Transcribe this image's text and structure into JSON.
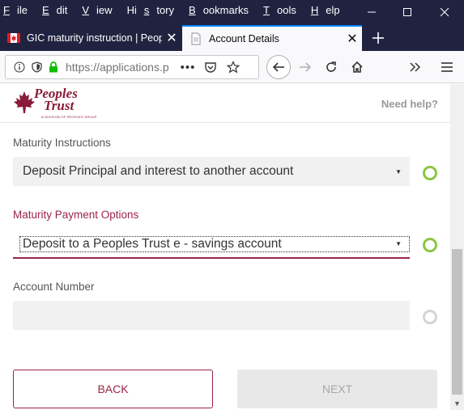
{
  "menu": {
    "items": [
      {
        "underline": "F",
        "rest": "ile"
      },
      {
        "underline": "E",
        "rest": "dit"
      },
      {
        "underline": "V",
        "rest": "iew"
      },
      {
        "pre": "Hi",
        "underline": "s",
        "rest": "tory"
      },
      {
        "underline": "B",
        "rest": "ookmarks"
      },
      {
        "underline": "T",
        "rest": "ools"
      },
      {
        "underline": "H",
        "rest": "elp"
      }
    ]
  },
  "tabs": {
    "inactive_title": "GIC maturity instruction | Peop",
    "active_title": "Account Details"
  },
  "navbar": {
    "url": "https://applications.p"
  },
  "header": {
    "logo_line1": "Peoples",
    "logo_line2": "Trust",
    "logo_sub": "A DIVISION OF PEOPLES GROUP",
    "need_help": "Need help?"
  },
  "form": {
    "maturity_instructions_label": "Maturity Instructions",
    "maturity_instructions_value": "Deposit Principal and interest to another account",
    "maturity_payment_label": "Maturity Payment Options",
    "maturity_payment_value": "Deposit to a Peoples Trust e - savings account",
    "account_number_label": "Account Number",
    "account_number_value": ""
  },
  "buttons": {
    "back": "BACK",
    "next": "NEXT"
  },
  "colors": {
    "brand": "#9b2446",
    "valid": "#8cc63f",
    "browser_frame": "#202340",
    "tab_accent": "#0a84ff"
  }
}
